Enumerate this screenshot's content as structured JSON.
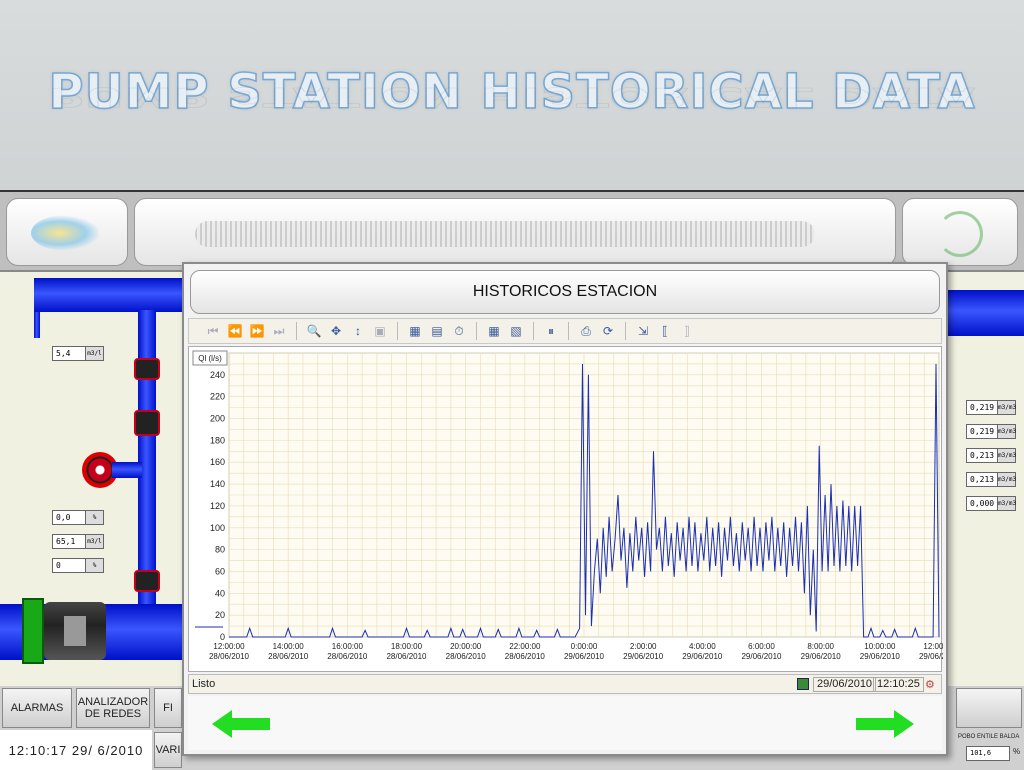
{
  "slide": {
    "title": "PUMP STATION HISTORICAL DATA"
  },
  "scada": {
    "fields_left": [
      {
        "value": "5,4",
        "unit": "m3/l"
      },
      {
        "value": "0,0",
        "unit": "%"
      },
      {
        "value": "65,1",
        "unit": "m3/l"
      },
      {
        "value": "0",
        "unit": "%"
      }
    ],
    "fields_right": [
      {
        "value": "0,219",
        "unit": "m3/m3"
      },
      {
        "value": "0,219",
        "unit": "m3/m3"
      },
      {
        "value": "0,213",
        "unit": "m3/m3"
      },
      {
        "value": "0,213",
        "unit": "m3/m3"
      },
      {
        "value": "0,000",
        "unit": "m3/m3"
      }
    ],
    "buttons": {
      "alarmas": "ALARMAS",
      "analizador": "ANALIZADOR\nDE REDES",
      "fi": "FI",
      "var": "VARI"
    },
    "clock": "12:10:17  29/ 6/2010",
    "right_label": "POBO ENTILE BALDA",
    "right_value": "101,6",
    "right_unit": "%"
  },
  "window": {
    "title": "HISTORICOS ESTACION",
    "status_text": "Listo",
    "status_date": "29/06/2010",
    "status_time": "12:10:25"
  },
  "colors": {
    "series": "#1c2fb0",
    "grid": "#e7ddb3",
    "arrow": "#22dd22"
  },
  "chart_data": {
    "type": "line",
    "ylabel": "Ql (l/s)",
    "ylim": [
      0,
      260
    ],
    "yticks": [
      0,
      20,
      40,
      60,
      80,
      100,
      120,
      140,
      160,
      180,
      200,
      220,
      240
    ],
    "xticks": [
      {
        "time": "12:00:00",
        "date": "28/06/2010"
      },
      {
        "time": "14:00:00",
        "date": "28/06/2010"
      },
      {
        "time": "16:00:00",
        "date": "28/06/2010"
      },
      {
        "time": "18:00:00",
        "date": "28/06/2010"
      },
      {
        "time": "20:00:00",
        "date": "28/06/2010"
      },
      {
        "time": "22:00:00",
        "date": "28/06/2010"
      },
      {
        "time": "0:00:00",
        "date": "29/06/2010"
      },
      {
        "time": "2:00:00",
        "date": "29/06/2010"
      },
      {
        "time": "4:00:00",
        "date": "29/06/2010"
      },
      {
        "time": "6:00:00",
        "date": "29/06/2010"
      },
      {
        "time": "8:00:00",
        "date": "29/06/2010"
      },
      {
        "time": "10:00:00",
        "date": "29/06/2010"
      },
      {
        "time": "12:00:00",
        "date": "29/06/2010"
      }
    ],
    "x_range_hours": [
      12,
      36
    ],
    "series": [
      {
        "points": [
          [
            12.0,
            0
          ],
          [
            12.6,
            0
          ],
          [
            12.7,
            8
          ],
          [
            12.8,
            0
          ],
          [
            13.9,
            0
          ],
          [
            14.0,
            8
          ],
          [
            14.1,
            0
          ],
          [
            15.4,
            0
          ],
          [
            15.5,
            8
          ],
          [
            15.6,
            0
          ],
          [
            16.5,
            0
          ],
          [
            16.6,
            6
          ],
          [
            16.7,
            0
          ],
          [
            17.9,
            0
          ],
          [
            18.0,
            8
          ],
          [
            18.1,
            0
          ],
          [
            18.6,
            0
          ],
          [
            18.7,
            6
          ],
          [
            18.8,
            0
          ],
          [
            19.4,
            0
          ],
          [
            19.5,
            8
          ],
          [
            19.6,
            0
          ],
          [
            19.8,
            0
          ],
          [
            19.9,
            7
          ],
          [
            20.0,
            0
          ],
          [
            20.4,
            0
          ],
          [
            20.5,
            8
          ],
          [
            20.6,
            0
          ],
          [
            21.0,
            0
          ],
          [
            21.1,
            7
          ],
          [
            21.2,
            0
          ],
          [
            21.7,
            0
          ],
          [
            21.8,
            8
          ],
          [
            21.9,
            0
          ],
          [
            22.3,
            0
          ],
          [
            22.4,
            6
          ],
          [
            22.5,
            0
          ],
          [
            23.0,
            0
          ],
          [
            23.1,
            7
          ],
          [
            23.2,
            0
          ],
          [
            23.7,
            0
          ],
          [
            23.85,
            8
          ],
          [
            23.95,
            250
          ],
          [
            24.05,
            20
          ],
          [
            24.15,
            240
          ],
          [
            24.25,
            10
          ],
          [
            24.35,
            60
          ],
          [
            24.45,
            90
          ],
          [
            24.55,
            40
          ],
          [
            24.65,
            100
          ],
          [
            24.75,
            55
          ],
          [
            24.85,
            110
          ],
          [
            24.95,
            60
          ],
          [
            25.05,
            90
          ],
          [
            25.15,
            130
          ],
          [
            25.25,
            70
          ],
          [
            25.35,
            100
          ],
          [
            25.45,
            45
          ],
          [
            25.55,
            95
          ],
          [
            25.65,
            60
          ],
          [
            25.75,
            110
          ],
          [
            25.85,
            70
          ],
          [
            25.95,
            100
          ],
          [
            26.05,
            55
          ],
          [
            26.15,
            105
          ],
          [
            26.25,
            60
          ],
          [
            26.35,
            170
          ],
          [
            26.45,
            80
          ],
          [
            26.55,
            100
          ],
          [
            26.65,
            60
          ],
          [
            26.75,
            110
          ],
          [
            26.85,
            65
          ],
          [
            26.95,
            95
          ],
          [
            27.05,
            55
          ],
          [
            27.15,
            105
          ],
          [
            27.25,
            70
          ],
          [
            27.35,
            100
          ],
          [
            27.45,
            60
          ],
          [
            27.55,
            110
          ],
          [
            27.65,
            65
          ],
          [
            27.75,
            105
          ],
          [
            27.85,
            60
          ],
          [
            27.95,
            95
          ],
          [
            28.05,
            70
          ],
          [
            28.15,
            110
          ],
          [
            28.25,
            60
          ],
          [
            28.35,
            100
          ],
          [
            28.45,
            65
          ],
          [
            28.55,
            105
          ],
          [
            28.65,
            55
          ],
          [
            28.75,
            100
          ],
          [
            28.85,
            70
          ],
          [
            28.95,
            110
          ],
          [
            29.05,
            65
          ],
          [
            29.15,
            95
          ],
          [
            29.25,
            60
          ],
          [
            29.35,
            105
          ],
          [
            29.45,
            70
          ],
          [
            29.55,
            100
          ],
          [
            29.65,
            60
          ],
          [
            29.75,
            110
          ],
          [
            29.85,
            65
          ],
          [
            29.95,
            100
          ],
          [
            30.05,
            60
          ],
          [
            30.15,
            105
          ],
          [
            30.25,
            70
          ],
          [
            30.35,
            110
          ],
          [
            30.45,
            60
          ],
          [
            30.55,
            100
          ],
          [
            30.65,
            65
          ],
          [
            30.75,
            105
          ],
          [
            30.85,
            55
          ],
          [
            30.95,
            100
          ],
          [
            31.05,
            65
          ],
          [
            31.15,
            110
          ],
          [
            31.25,
            60
          ],
          [
            31.35,
            105
          ],
          [
            31.45,
            40
          ],
          [
            31.55,
            120
          ],
          [
            31.65,
            20
          ],
          [
            31.75,
            80
          ],
          [
            31.85,
            5
          ],
          [
            31.95,
            175
          ],
          [
            32.05,
            60
          ],
          [
            32.15,
            130
          ],
          [
            32.25,
            60
          ],
          [
            32.35,
            140
          ],
          [
            32.45,
            65
          ],
          [
            32.55,
            120
          ],
          [
            32.65,
            60
          ],
          [
            32.75,
            125
          ],
          [
            32.85,
            65
          ],
          [
            32.95,
            120
          ],
          [
            33.05,
            60
          ],
          [
            33.15,
            120
          ],
          [
            33.25,
            65
          ],
          [
            33.35,
            120
          ],
          [
            33.45,
            0
          ],
          [
            33.6,
            0
          ],
          [
            33.7,
            8
          ],
          [
            33.8,
            0
          ],
          [
            34.0,
            0
          ],
          [
            34.1,
            6
          ],
          [
            34.2,
            0
          ],
          [
            34.4,
            0
          ],
          [
            34.5,
            7
          ],
          [
            34.6,
            0
          ],
          [
            35.1,
            0
          ],
          [
            35.2,
            8
          ],
          [
            35.3,
            0
          ],
          [
            35.8,
            0
          ],
          [
            35.9,
            250
          ],
          [
            36.0,
            0
          ]
        ]
      }
    ]
  }
}
